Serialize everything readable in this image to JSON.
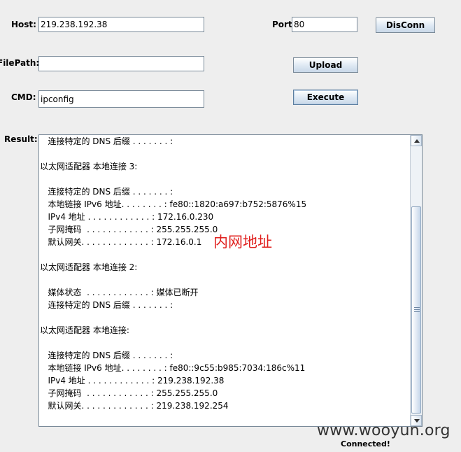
{
  "form": {
    "host_label": "Host:",
    "host_value": "219.238.192.38",
    "port_label": "Port:",
    "port_value": "80",
    "disconn_label": "DisConn",
    "filepath_label": "FilePath:",
    "filepath_value": "",
    "upload_label": "Upload",
    "cmd_label": "CMD:",
    "cmd_value": "ipconfig",
    "execute_label": "Execute",
    "result_label": "Result:"
  },
  "result_lines": [
    "   连接特定的 DNS 后缀 . . . . . . . :",
    "",
    "以太网适配器 本地连接 3:",
    "",
    "   连接特定的 DNS 后缀 . . . . . . . :",
    "   本地链接 IPv6 地址. . . . . . . . : fe80::1820:a697:b752:5876%15",
    "   IPv4 地址 . . . . . . . . . . . . : 172.16.0.230",
    "   子网掩码  . . . . . . . . . . . . : 255.255.255.0",
    "   默认网关. . . . . . . . . . . . . : 172.16.0.1",
    "",
    "以太网适配器 本地连接 2:",
    "",
    "   媒体状态  . . . . . . . . . . . . : 媒体已断开",
    "   连接特定的 DNS 后缀 . . . . . . . :",
    "",
    "以太网适配器 本地连接:",
    "",
    "   连接特定的 DNS 后缀 . . . . . . . :",
    "   本地链接 IPv6 地址. . . . . . . . : fe80::9c55:b985:7034:186c%11",
    "   IPv4 地址 . . . . . . . . . . . . : 219.238.192.38",
    "   子网掩码  . . . . . . . . . . . . : 255.255.255.0",
    "   默认网关. . . . . . . . . . . . . : 219.238.192.254"
  ],
  "annotation": "内网地址",
  "watermark": "www.wooyun.org",
  "status": "Connected!",
  "icons": {
    "scroll_up": "triangle-up-icon",
    "scroll_down": "triangle-down-icon",
    "thumb_grip": "grip-lines-icon"
  },
  "colors": {
    "background": "#eeeeee",
    "annotation": "#e0201e",
    "field_border": "#7a8a99"
  }
}
